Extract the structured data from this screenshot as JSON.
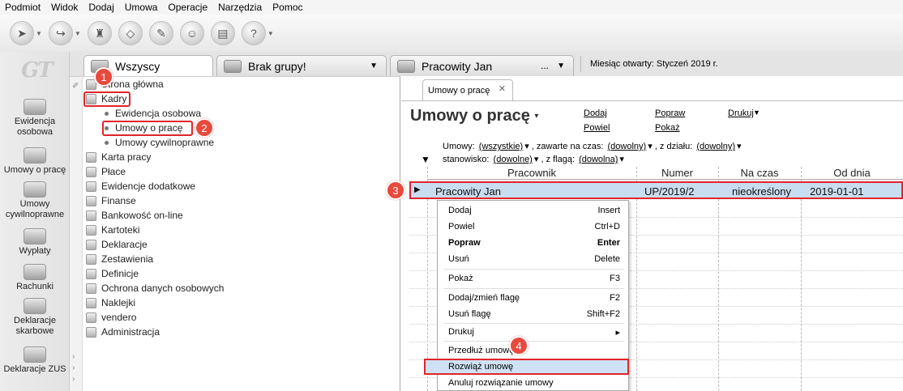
{
  "menubar": [
    "Podmiot",
    "Widok",
    "Dodaj",
    "Umowa",
    "Operacje",
    "Narzędzia",
    "Pomoc"
  ],
  "logo": "GT",
  "leftbar": [
    {
      "label": "Ewidencja osobowa",
      "icon": "people-icon"
    },
    {
      "label": "Umowy o pracę",
      "icon": "contract-icon"
    },
    {
      "label": "Umowy cywilnoprawne",
      "icon": "contract-civil-icon"
    },
    {
      "label": "Wypłaty",
      "icon": "payout-icon"
    },
    {
      "label": "Rachunki",
      "icon": "bill-icon"
    },
    {
      "label": "Deklaracje skarbowe",
      "icon": "tax-icon"
    },
    {
      "label": "Deklaracje ZUS",
      "icon": "zus-icon"
    }
  ],
  "tabs": {
    "all": "Wszyscy",
    "group": "Brak grupy!",
    "employee": "Pracowity Jan",
    "employee_more": "...",
    "month": "Miesiąc otwarty: Styczeń 2019 r."
  },
  "tree": {
    "items": [
      "Strona główna",
      "Kadry",
      "Ewidencja osobowa",
      "Umowy o pracę",
      "Umowy cywilnoprawne",
      "Karta pracy",
      "Płace",
      "Ewidencje dodatkowe",
      "Finanse",
      "Bankowość on-line",
      "Kartoteki",
      "Deklaracje",
      "Zestawienia",
      "Definicje",
      "Ochrona danych osobowych",
      "Naklejki",
      "vendero",
      "Administracja"
    ]
  },
  "badges": [
    "1",
    "2",
    "3",
    "4"
  ],
  "main": {
    "tab_label": "Umowy o pracę",
    "title": "Umowy o pracę",
    "actions": {
      "add": "Dodaj",
      "duplicate": "Powiel",
      "edit": "Popraw",
      "show": "Pokaż",
      "print": "Drukuj"
    },
    "filters": {
      "contracts_label": "Umowy:",
      "contracts_value": "(wszystkie)",
      "term_label": ", zawarte na czas:",
      "term_value": "(dowolny)",
      "dept_label": ", z działu:",
      "dept_value": "(dowolny)",
      "position_label": "stanowisko:",
      "position_value": "(dowolne)",
      "flag_label": ", z flagą:",
      "flag_value": "(dowolna)"
    },
    "columns": [
      "Pracownik",
      "Numer",
      "Na czas",
      "Od dnia"
    ],
    "rows": [
      {
        "employee": "Pracowity Jan",
        "number": "UP/2019/2",
        "term": "nieokreślony",
        "from": "2019-01-01"
      }
    ]
  },
  "context_menu": [
    {
      "label": "Dodaj",
      "shortcut": "Insert"
    },
    {
      "label": "Powiel",
      "shortcut": "Ctrl+D"
    },
    {
      "label": "Popraw",
      "shortcut": "Enter"
    },
    {
      "label": "Usuń",
      "shortcut": "Delete"
    },
    {
      "label": "Pokaż",
      "shortcut": "F3"
    },
    {
      "label": "Dodaj/zmień flagę",
      "shortcut": "F2"
    },
    {
      "label": "Usuń flagę",
      "shortcut": "Shift+F2"
    },
    {
      "label": "Drukuj",
      "shortcut": "▸"
    },
    {
      "label": "Przedłuż umowę",
      "shortcut": ""
    },
    {
      "label": "Rozwiąż umowę",
      "shortcut": ""
    },
    {
      "label": "Anuluj rozwiązanie umowy",
      "shortcut": ""
    }
  ],
  "colors": {
    "highlight_red": "#e0252b",
    "badge_red": "#e84a3d",
    "selection_blue": "#c9ddf1"
  }
}
